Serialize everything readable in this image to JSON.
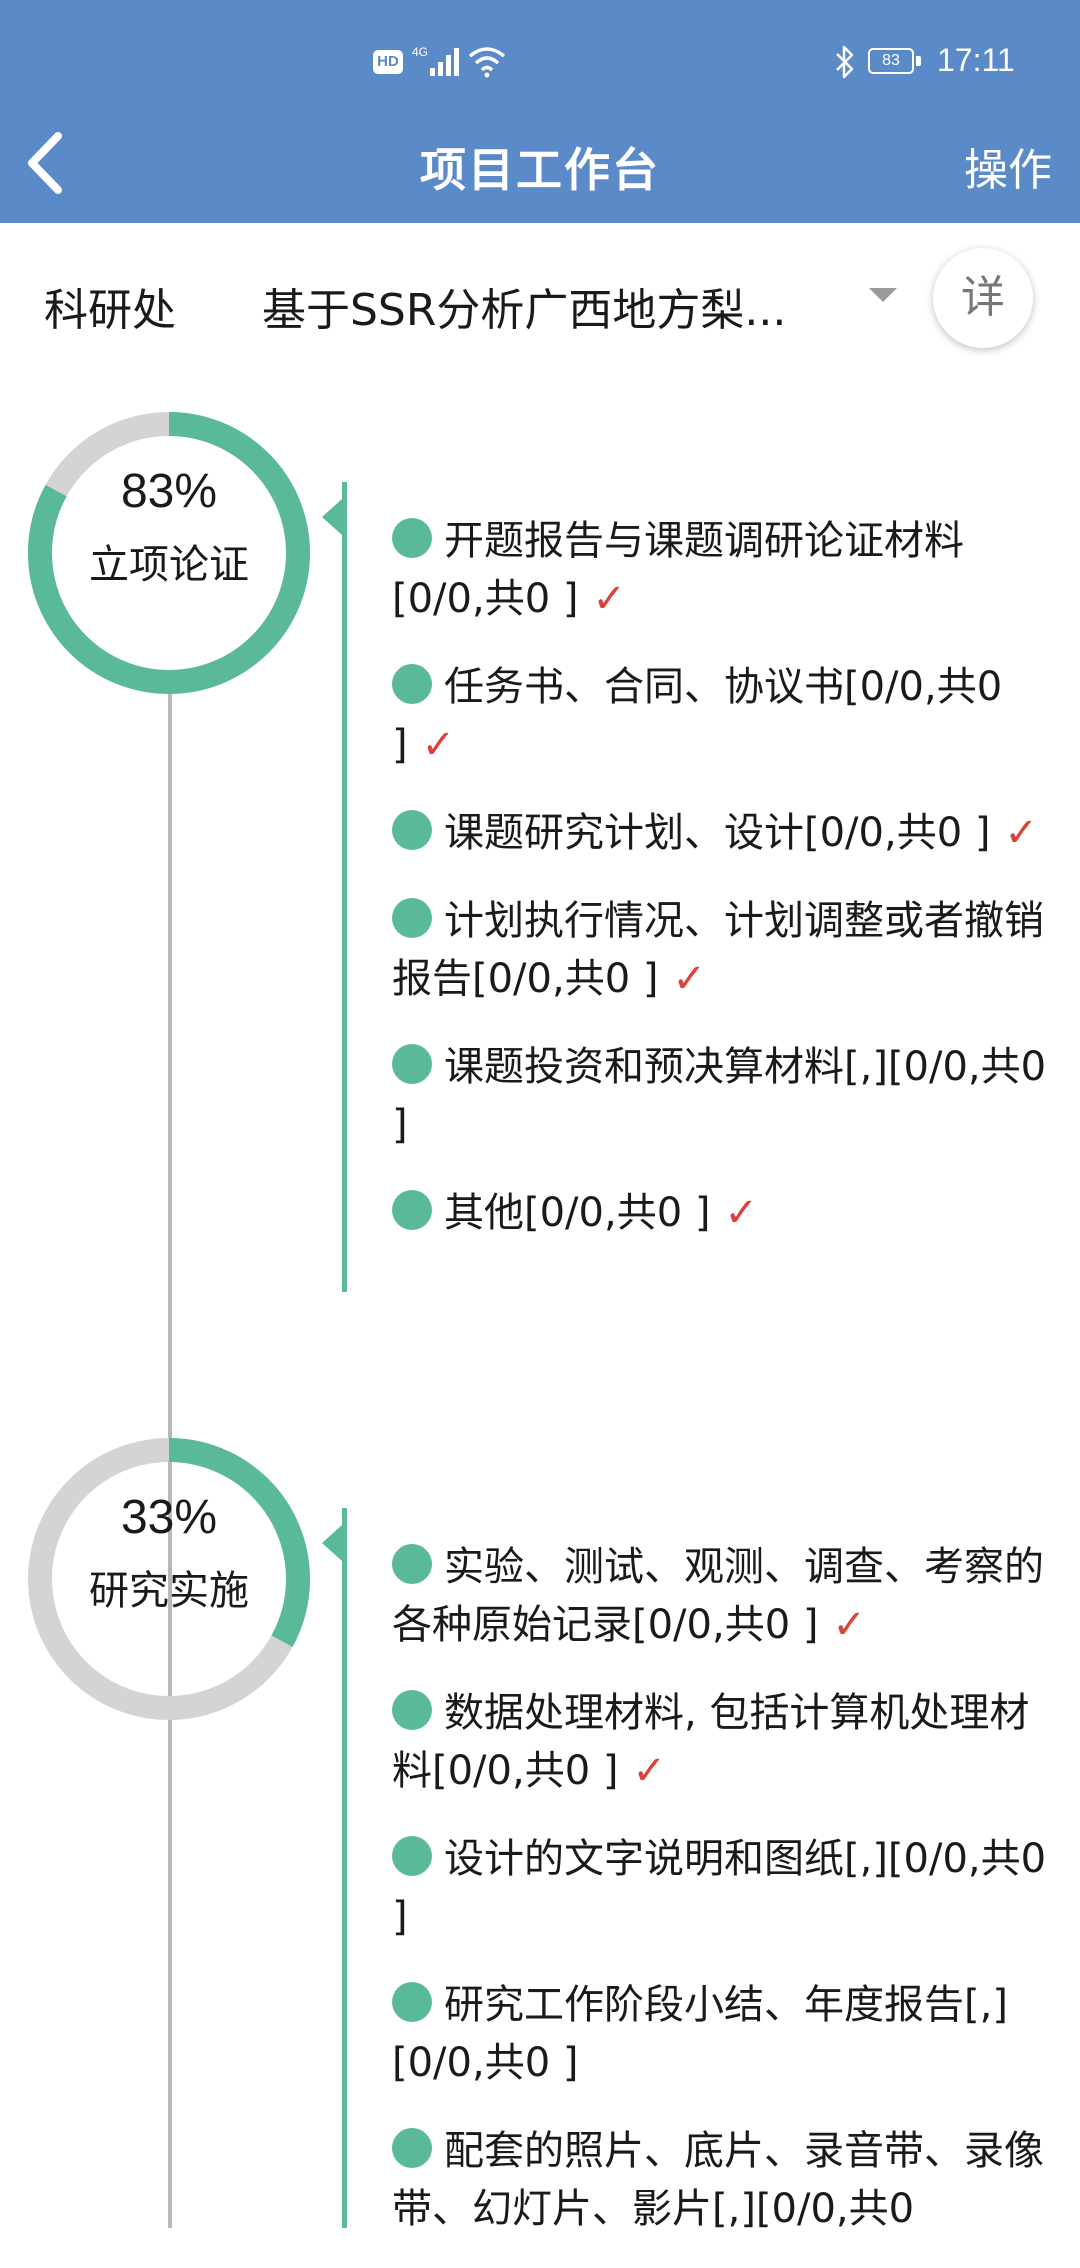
{
  "status_bar": {
    "hd": "HD",
    "network": "4G",
    "battery": "83",
    "time": "17:11"
  },
  "header": {
    "title": "项目工作台",
    "action": "操作"
  },
  "selector": {
    "department": "科研处",
    "project": "基于SSR分析广西地方梨...",
    "detail": "详"
  },
  "colors": {
    "header_bg": "#5b8ac9",
    "accent": "#5aba98",
    "ring_track": "#d4d4d4",
    "check": "#d9433a"
  },
  "stages": [
    {
      "percent": "83%",
      "progress": 0.83,
      "label": "立项论证",
      "items": [
        {
          "text": "开题报告与课题调研论证材料[0/0,共0 ]",
          "check": "✓"
        },
        {
          "text": "任务书、合同、协议书[0/0,共0 ]",
          "check": "✓"
        },
        {
          "text": "课题研究计划、设计[0/0,共0 ]",
          "check": "✓"
        },
        {
          "text": "计划执行情况、计划调整或者撤销报告[0/0,共0 ]",
          "check": "✓"
        },
        {
          "text": "课题投资和预决算材料[,][0/0,共0 ]",
          "check": ""
        },
        {
          "text": "其他[0/0,共0 ]",
          "check": "✓"
        }
      ]
    },
    {
      "percent": "33%",
      "progress": 0.33,
      "label": "研究实施",
      "items": [
        {
          "text": "实验、测试、观测、调查、考察的各种原始记录[0/0,共0 ]",
          "check": "✓"
        },
        {
          "text": "数据处理材料, 包括计算机处理材料[0/0,共0 ]",
          "check": "✓"
        },
        {
          "text": "设计的文字说明和图纸[,][0/0,共0 ]",
          "check": ""
        },
        {
          "text": "研究工作阶段小结、年度报告[,][0/0,共0 ]",
          "check": ""
        },
        {
          "text": "配套的照片、底片、录音带、录像带、幻灯片、影片[,][0/0,共0",
          "check": ""
        }
      ]
    }
  ]
}
